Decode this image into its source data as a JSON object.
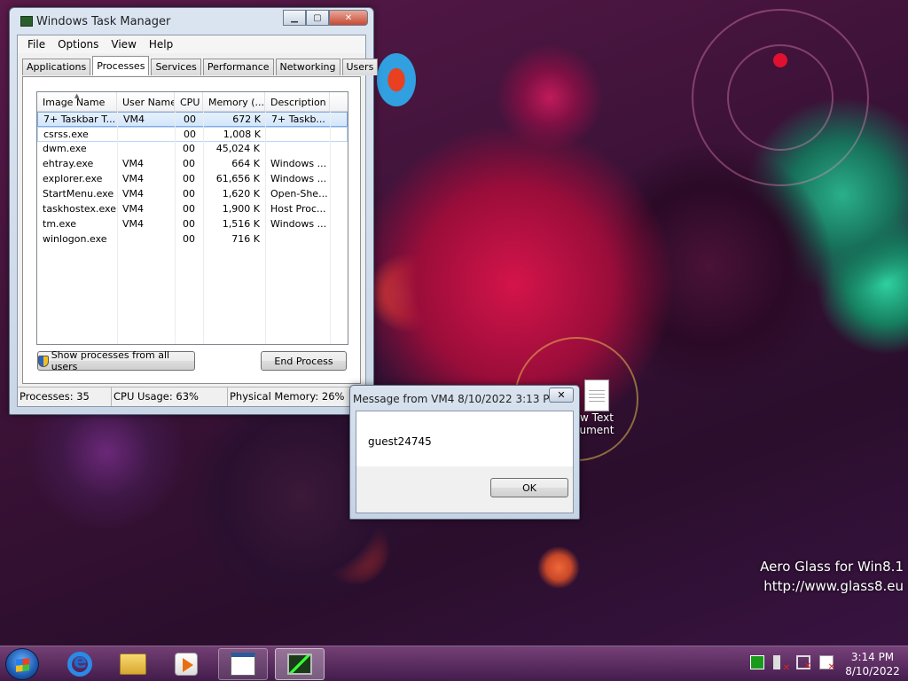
{
  "task_manager": {
    "title": "Windows Task Manager",
    "menu": [
      "File",
      "Options",
      "View",
      "Help"
    ],
    "tabs": [
      "Applications",
      "Processes",
      "Services",
      "Performance",
      "Networking",
      "Users"
    ],
    "active_tab": "Processes",
    "columns": [
      "Image Name",
      "User Name",
      "CPU",
      "Memory (...",
      "Description"
    ],
    "rows": [
      {
        "image": "7+ Taskbar T...",
        "user": "VM4",
        "cpu": "00",
        "memory": "672 K",
        "description": "7+ Taskb..."
      },
      {
        "image": "csrss.exe",
        "user": "",
        "cpu": "00",
        "memory": "1,008 K",
        "description": ""
      },
      {
        "image": "dwm.exe",
        "user": "",
        "cpu": "00",
        "memory": "45,024 K",
        "description": ""
      },
      {
        "image": "ehtray.exe",
        "user": "VM4",
        "cpu": "00",
        "memory": "664 K",
        "description": "Windows ..."
      },
      {
        "image": "explorer.exe",
        "user": "VM4",
        "cpu": "00",
        "memory": "61,656 K",
        "description": "Windows ..."
      },
      {
        "image": "StartMenu.exe",
        "user": "VM4",
        "cpu": "00",
        "memory": "1,620 K",
        "description": "Open-She..."
      },
      {
        "image": "taskhostex.exe",
        "user": "VM4",
        "cpu": "00",
        "memory": "1,900 K",
        "description": "Host Proc..."
      },
      {
        "image": "tm.exe",
        "user": "VM4",
        "cpu": "00",
        "memory": "1,516 K",
        "description": "Windows ..."
      },
      {
        "image": "winlogon.exe",
        "user": "",
        "cpu": "00",
        "memory": "716 K",
        "description": ""
      }
    ],
    "show_all_button": "Show processes from all users",
    "end_process_button": "End Process",
    "status": {
      "processes": "Processes: 35",
      "cpu": "CPU Usage: 63%",
      "memory": "Physical Memory: 26%"
    }
  },
  "message_box": {
    "title": "Message from VM4 8/10/2022 3:13 PM",
    "close": "✕",
    "text": "guest24745",
    "ok_button": "OK"
  },
  "desktop_icon": {
    "line1": "w Text",
    "line2": "ument"
  },
  "watermark": {
    "line1": "Aero Glass for Win8.1",
    "line2": "http://www.glass8.eu"
  },
  "taskbar": {
    "clock_time": "3:14 PM",
    "clock_date": "8/10/2022"
  }
}
